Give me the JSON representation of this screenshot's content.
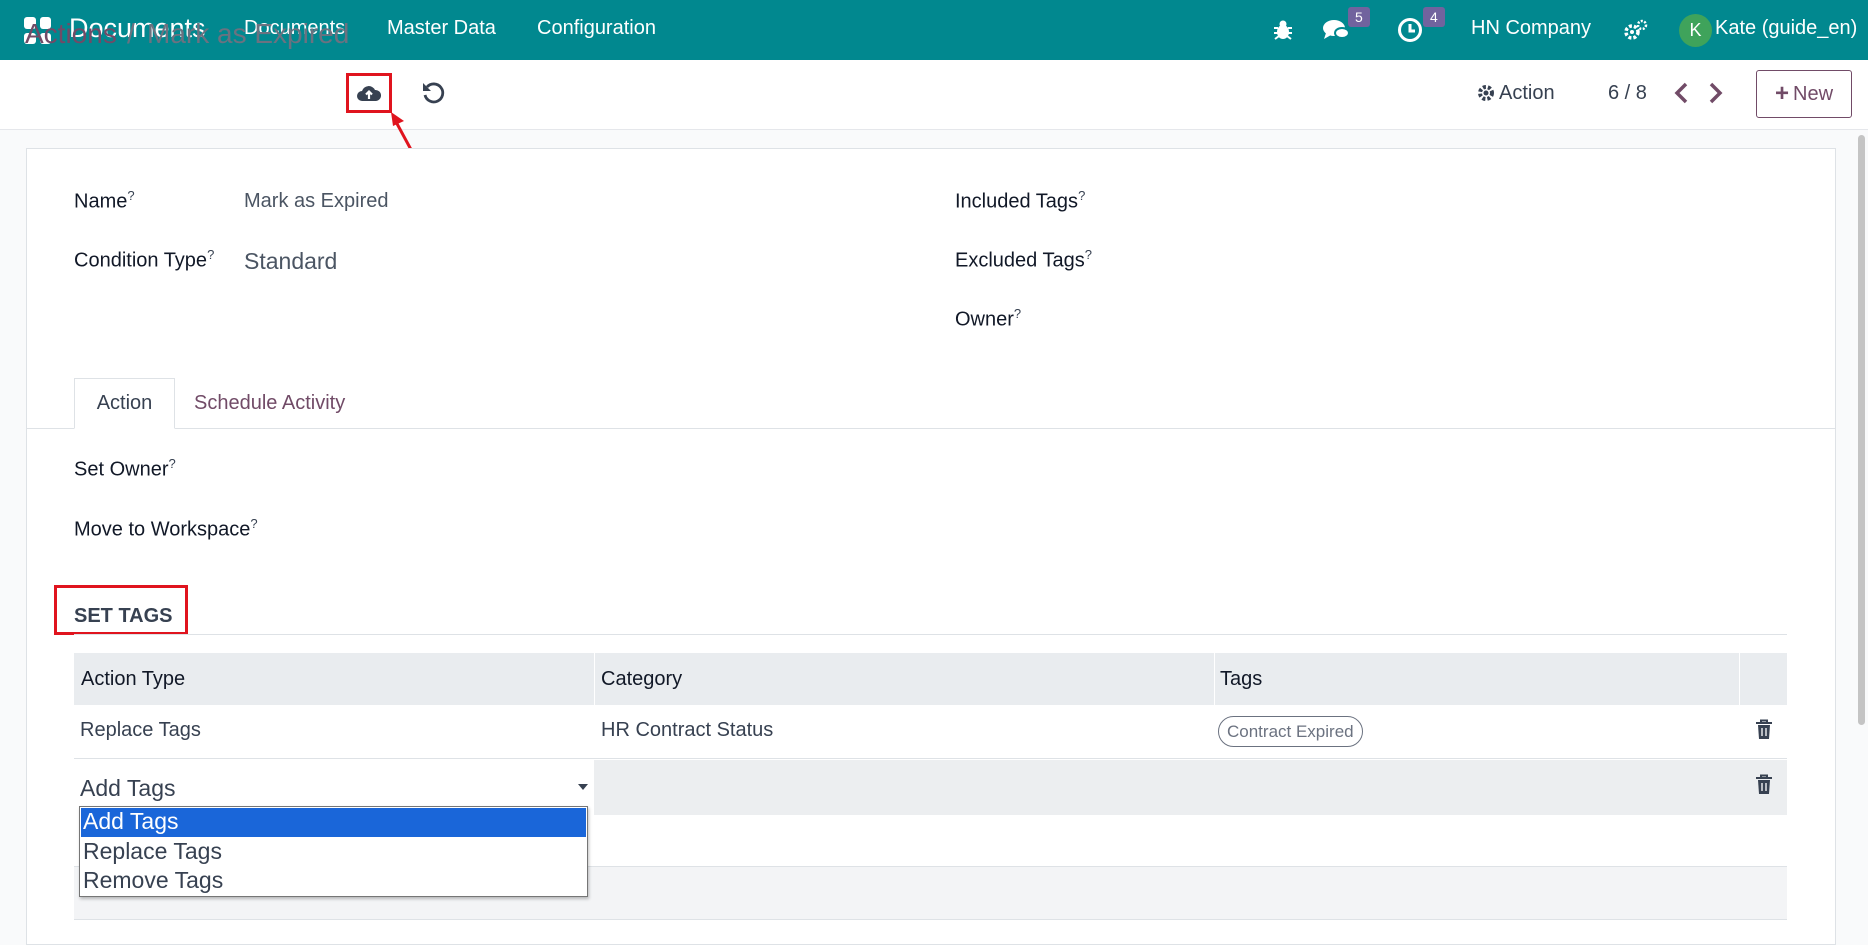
{
  "navbar": {
    "brand": "Documents",
    "menu": [
      "Documents",
      "Master Data",
      "Configuration"
    ],
    "messages_count": "5",
    "activities_count": "4",
    "company": "HN Company",
    "avatar_initial": "K",
    "user": "Kate (guide_en)"
  },
  "control": {
    "breadcrumb_parent": "Actions",
    "breadcrumb_sep": "/",
    "breadcrumb_current": "Mark as Expired",
    "action_label": "Action",
    "pager": "6 / 8",
    "new_label": "New"
  },
  "form": {
    "name_label": "Name",
    "name_value": "Mark as Expired",
    "condition_label": "Condition Type",
    "condition_value": "Standard",
    "included_tags_label": "Included Tags",
    "excluded_tags_label": "Excluded Tags",
    "owner_label": "Owner",
    "help_mark": "?"
  },
  "tabs": [
    "Action",
    "Schedule Activity"
  ],
  "action_tab": {
    "set_owner_label": "Set Owner",
    "move_workspace_label": "Move to Workspace",
    "set_tags_heading": "SET TAGS"
  },
  "table": {
    "headers": [
      "Action Type",
      "Category",
      "Tags"
    ],
    "rows": [
      {
        "action_type": "Replace Tags",
        "category": "HR Contract Status",
        "tags": [
          "Contract Expired"
        ]
      }
    ],
    "editing_row_value": "Add Tags",
    "dropdown_options": [
      "Add Tags",
      "Replace Tags",
      "Remove Tags"
    ],
    "dropdown_selected": "Add Tags"
  },
  "colors": {
    "navbar": "#01888f",
    "brand_purple": "#714b67",
    "highlight_red": "#e0141e",
    "selected_option": "#1a66d9"
  }
}
